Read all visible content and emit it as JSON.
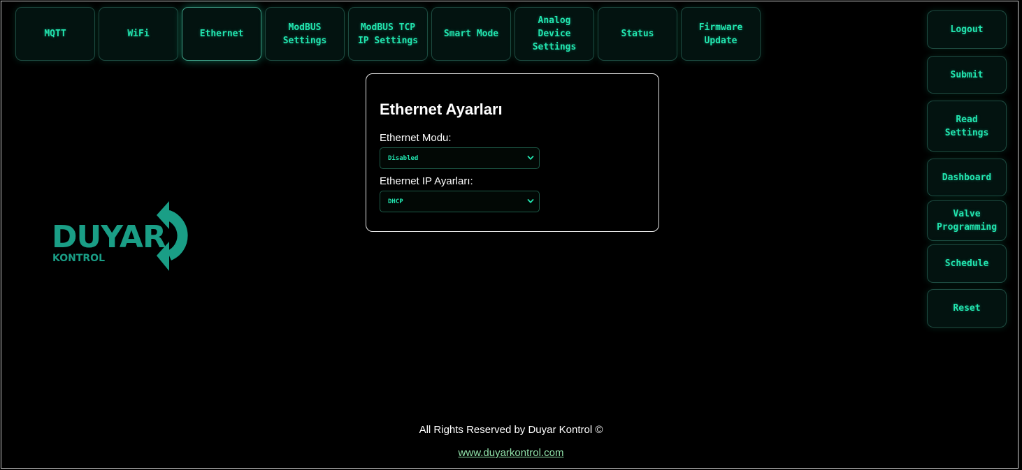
{
  "tabs": [
    {
      "label": "MQTT"
    },
    {
      "label": "WiFi"
    },
    {
      "label": "Ethernet"
    },
    {
      "label": "ModBUS\nSettings"
    },
    {
      "label": "ModBUS TCP\nIP Settings"
    },
    {
      "label": "Smart Mode"
    },
    {
      "label": "Analog\nDevice\nSettings"
    },
    {
      "label": "Status"
    },
    {
      "label": "Firmware\nUpdate"
    }
  ],
  "active_tab": "Ethernet",
  "side_buttons": [
    {
      "label": "Logout"
    },
    {
      "label": "Submit"
    },
    {
      "label": "Read\nSettings"
    },
    {
      "label": "Dashboard"
    },
    {
      "label": "Valve\nProgramming"
    },
    {
      "label": "Schedule"
    },
    {
      "label": "Reset"
    }
  ],
  "panel": {
    "title": "Ethernet Ayarları",
    "mode_label": "Ethernet Modu:",
    "mode_value": "Disabled",
    "ip_label": "Ethernet IP Ayarları:",
    "ip_value": "DHCP"
  },
  "logo": {
    "name": "DUYAR",
    "sub": "KONTROL",
    "color": "#1a9e86"
  },
  "footer": {
    "text": "All Rights Reserved by Duyar Kontrol ©",
    "link_text": "www.duyarkontrol.com"
  },
  "colors": {
    "accent": "#22e6b0",
    "background": "#000000"
  }
}
